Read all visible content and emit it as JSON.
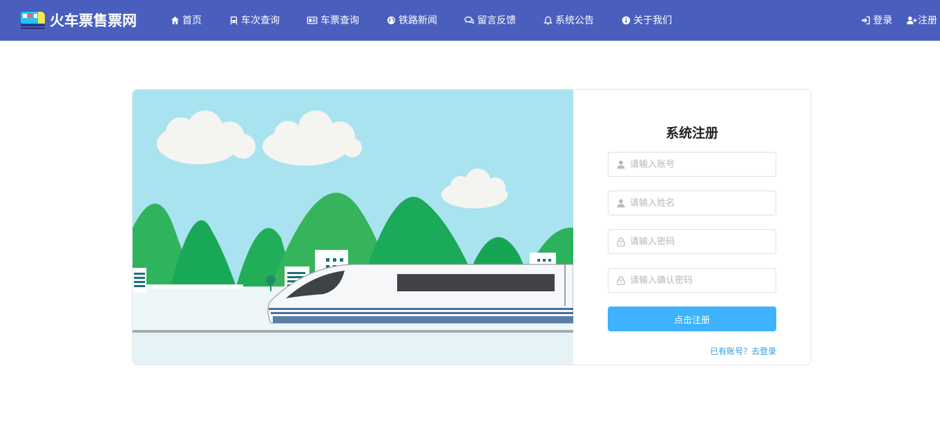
{
  "brand": {
    "name": "火车票售票网",
    "logo_icon": "train-logo-icon"
  },
  "nav": {
    "items": [
      {
        "label": "首页",
        "icon": "home-icon"
      },
      {
        "label": "车次查询",
        "icon": "train-icon"
      },
      {
        "label": "车票查询",
        "icon": "ticket-icon"
      },
      {
        "label": "铁路新闻",
        "icon": "globe-icon"
      },
      {
        "label": "留言反馈",
        "icon": "comments-icon"
      },
      {
        "label": "系统公告",
        "icon": "bell-icon"
      },
      {
        "label": "关于我们",
        "icon": "info-icon"
      }
    ],
    "login_label": "登录",
    "register_label": "注册"
  },
  "register_form": {
    "title": "系统注册",
    "fields": [
      {
        "placeholder": "请输入账号",
        "icon": "user-icon",
        "value": ""
      },
      {
        "placeholder": "请输入姓名",
        "icon": "user-icon",
        "value": ""
      },
      {
        "placeholder": "请输入密码",
        "icon": "lock-icon",
        "value": ""
      },
      {
        "placeholder": "请输入确认密码",
        "icon": "lock-icon",
        "value": ""
      }
    ],
    "submit_label": "点击注册",
    "login_link": "已有账号？去登录"
  },
  "colors": {
    "navbar": "#4a5fbd",
    "primary_button": "#3eb2fd",
    "link": "#2d9ee0",
    "sky": "#a9e3ef",
    "mountain": "#1fae5a"
  }
}
